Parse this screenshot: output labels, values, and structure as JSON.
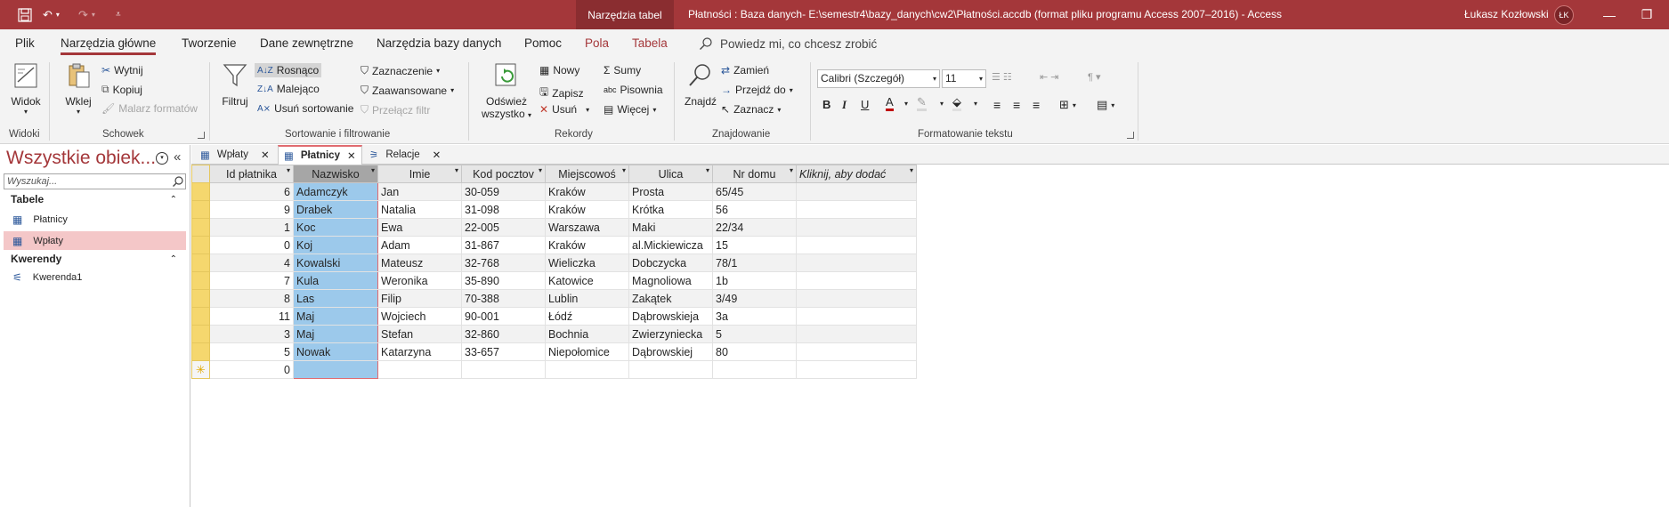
{
  "titlebar": {
    "context_tools": "Narzędzia tabel",
    "doc_title": "Płatności : Baza danych- E:\\semestr4\\bazy_danych\\cw2\\Płatności.accdb (format pliku programu Access 2007–2016)  -  Access",
    "user_name": "Łukasz Kozłowski",
    "user_initials": "ŁK",
    "accent_color": "#a4373a"
  },
  "menu": {
    "tabs": [
      "Plik",
      "Narzędzia główne",
      "Tworzenie",
      "Dane zewnętrzne",
      "Narzędzia bazy danych",
      "Pomoc",
      "Pola",
      "Tabela"
    ],
    "tell_me": "Powiedz mi, co chcesz zrobić"
  },
  "ribbon": {
    "widoki": {
      "label": "Widoki",
      "widok": "Widok"
    },
    "schowek": {
      "label": "Schowek",
      "wklej": "Wklej",
      "wytnij": "Wytnij",
      "kopiuj": "Kopiuj",
      "malarz": "Malarz formatów"
    },
    "sortowanie": {
      "label": "Sortowanie i filtrowanie",
      "filtruj": "Filtruj",
      "rosnaco": "Rosnąco",
      "malejaco": "Malejąco",
      "usun_sort": "Usuń sortowanie",
      "zaznaczenie": "Zaznaczenie",
      "zaawansowane": "Zaawansowane",
      "przelacz_filtr": "Przełącz filtr"
    },
    "rekordy": {
      "label": "Rekordy",
      "odswiez_1": "Odśwież",
      "odswiez_2": "wszystko",
      "nowy": "Nowy",
      "zapisz": "Zapisz",
      "usun": "Usuń",
      "sumy": "Sumy",
      "pisownia": "Pisownia",
      "wiecej": "Więcej"
    },
    "znajdowanie": {
      "label": "Znajdowanie",
      "znajdz": "Znajdź",
      "zamien": "Zamień",
      "przejdz": "Przejdź do",
      "zaznacz": "Zaznacz"
    },
    "formatowanie": {
      "label": "Formatowanie tekstu",
      "font": "Calibri (Szczegół)",
      "size": "11"
    }
  },
  "nav": {
    "title": "Wszystkie obiek...",
    "search_placeholder": "Wyszukaj...",
    "groups": [
      {
        "label": "Tabele",
        "items": [
          "Płatnicy",
          "Wpłaty"
        ]
      },
      {
        "label": "Kwerendy",
        "items": [
          "Kwerenda1"
        ]
      }
    ]
  },
  "doc_tabs": [
    "Wpłaty",
    "Płatnicy",
    "Relacje"
  ],
  "table": {
    "columns": [
      "Id płatnika",
      "Nazwisko",
      "Imie",
      "Kod pocztov",
      "Miejscowoś",
      "Ulica",
      "Nr domu",
      "Kliknij, aby dodać"
    ],
    "rows": [
      [
        "6",
        "Adamczyk",
        "Jan",
        "30-059",
        "Kraków",
        "Prosta",
        "65/45"
      ],
      [
        "9",
        "Drabek",
        "Natalia",
        "31-098",
        "Kraków",
        "Krótka",
        "56"
      ],
      [
        "1",
        "Koc",
        "Ewa",
        "22-005",
        "Warszawa",
        "Maki",
        "22/34"
      ],
      [
        "0",
        "Koj",
        "Adam",
        "31-867",
        "Kraków",
        "al.Mickiewicza",
        "15"
      ],
      [
        "4",
        "Kowalski",
        "Mateusz",
        "32-768",
        "Wieliczka",
        "Dobczycka",
        "78/1"
      ],
      [
        "7",
        "Kula",
        "Weronika",
        "35-890",
        "Katowice",
        "Magnoliowa",
        "1b"
      ],
      [
        "8",
        "Las",
        "Filip",
        "70-388",
        "Lublin",
        "Zakątek",
        "3/49"
      ],
      [
        "11",
        "Maj",
        "Wojciech",
        "90-001",
        "Łódź",
        "Dąbrowskieja",
        "3a"
      ],
      [
        "3",
        "Maj",
        "Stefan",
        "32-860",
        "Bochnia",
        "Zwierzyniecka",
        "5"
      ],
      [
        "5",
        "Nowak",
        "Katarzyna",
        "33-657",
        "Niepołomice",
        "Dąbrowskiej",
        "80"
      ]
    ],
    "new_row_id": "0"
  }
}
